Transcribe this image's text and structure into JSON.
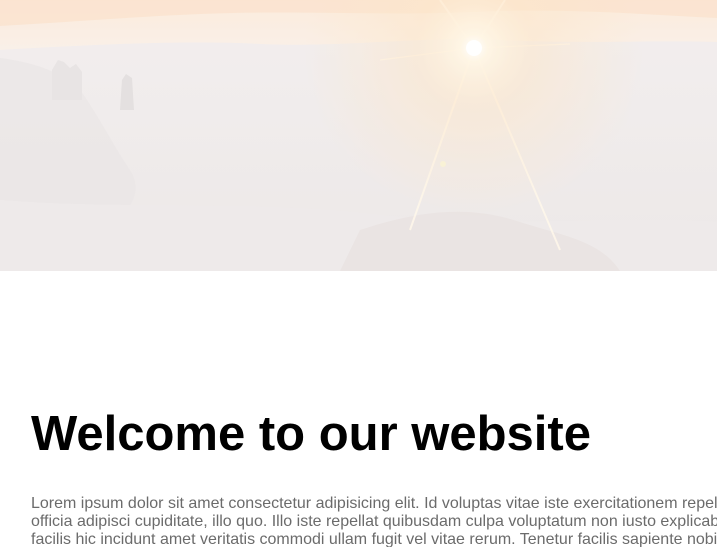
{
  "hero": {
    "image_icon": "sunset-canyon-hero-image"
  },
  "content": {
    "headline": "Welcome to our website",
    "paragraph_lines": [
      "Lorem ipsum dolor sit amet consectetur adipisicing elit. Id voluptas vitae iste exercitationem repel",
      "officia adipisci cupiditate, illo quo. Illo iste repellat quibusdam culpa voluptatum non iusto explicab",
      "facilis hic incidunt amet veritatis commodi ullam fugit vel vitae rerum. Tenetur facilis sapiente nobi"
    ]
  },
  "colors": {
    "headline": "#000000",
    "paragraph": "#6b6b6b",
    "background": "#ffffff"
  }
}
